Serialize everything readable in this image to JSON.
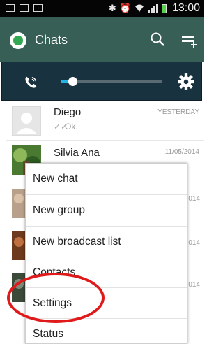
{
  "status_bar": {
    "time": "13:00",
    "left_icons": [
      "mail-icon",
      "upload-icon",
      "clipboard-icon"
    ],
    "right_icons": [
      "bluetooth-icon",
      "alarm-icon",
      "wifi-icon",
      "signal-icon",
      "battery-icon"
    ]
  },
  "action_bar": {
    "title": "Chats",
    "icons": [
      "whatsapp-logo-icon",
      "search-icon",
      "new-chat-icon"
    ],
    "background": "#385f55"
  },
  "quick_settings": {
    "brightness_level": 0.12,
    "icons": [
      "call-icon",
      "gear-icon"
    ],
    "accent": "#24b4e6"
  },
  "chats": [
    {
      "name": "Diego",
      "message": "Ok.",
      "time": "YESTERDAY"
    },
    {
      "name": "Silvia Ana",
      "message": "",
      "time": "11/05/2014"
    }
  ],
  "partial_times": [
    "014",
    "014",
    "014"
  ],
  "menu": {
    "items": [
      {
        "label": "New chat"
      },
      {
        "label": "New group"
      },
      {
        "label": "New broadcast list"
      },
      {
        "label": "Contacts"
      },
      {
        "label": "Settings"
      },
      {
        "label": "Status"
      }
    ]
  },
  "annotation": {
    "color": "#e01a1a",
    "target": "Settings"
  }
}
